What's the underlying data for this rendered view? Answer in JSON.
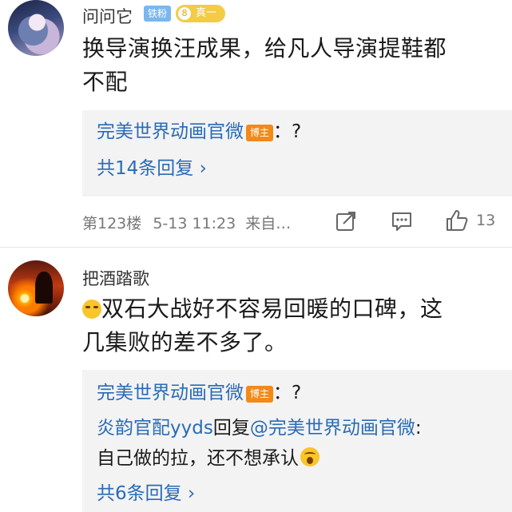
{
  "comments": [
    {
      "username": "问问它",
      "badge_fans": "铁粉",
      "badge_level_num": "8",
      "badge_level_text": "真一",
      "content_line1": "换导演换汪成果，给凡人导演提鞋都",
      "content_line2": "不配",
      "reply_author": "完美世界动画官微",
      "reply_author_tag": "博主",
      "reply_text": "：?",
      "reply_count": "共14条回复 ›",
      "floor": "第123楼",
      "time": "5-13 11:23",
      "source": "来自…",
      "like_count": "13"
    },
    {
      "username": "把酒踏歌",
      "content_line1": "双石大战好不容易回暖的口碑，这",
      "content_line2": "几集败的差不多了。",
      "reply1_author": "完美世界动画官微",
      "reply1_author_tag": "博主",
      "reply1_text": "：?",
      "reply2_author": "炎韵官配yyds",
      "reply2_mid": "回复",
      "reply2_mention": "@完美世界动画官微",
      "reply2_colon": ":",
      "reply2_line2": "自己做的拉，还不想承认",
      "reply_count": "共6条回复 ›"
    }
  ],
  "icons": [
    "share-icon",
    "comment-icon",
    "thumbs-up-icon",
    "crying-laughing-emoji",
    "shocked-emoji"
  ],
  "colors": {
    "link": "#2a6bb6",
    "blogger_tag": "#f28a1a",
    "fans_badge": "#79b7ef",
    "level_badge": "#f3cb44"
  }
}
